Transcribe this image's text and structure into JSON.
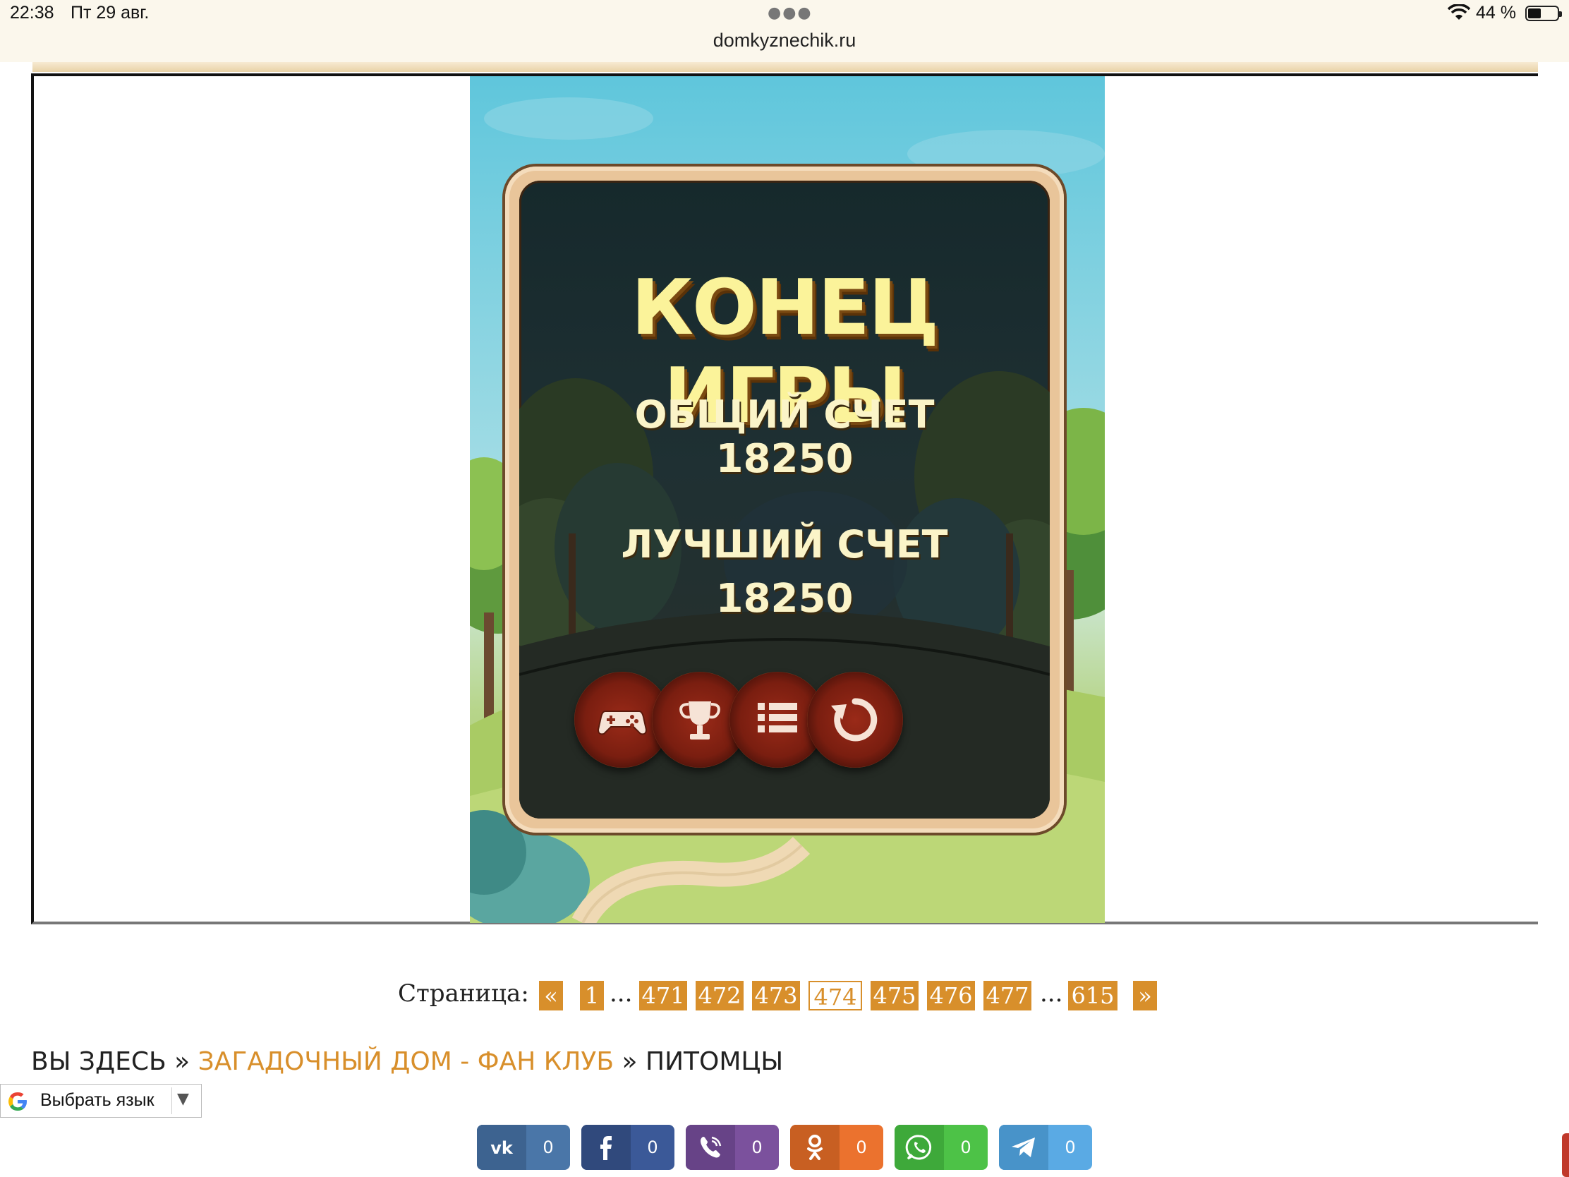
{
  "status_bar": {
    "time": "22:38",
    "date": "Пт 29 авг.",
    "url": "domkyznechik.ru",
    "battery_percent": "44 %",
    "battery_level": 0.44
  },
  "game": {
    "title": "КОНЕЦ ИГРЫ",
    "total_label": "ОБЩИЙ СЧЕТ",
    "total_value": "18250",
    "best_label": "ЛУЧШИЙ СЧЕТ",
    "best_value": "18250",
    "buttons": [
      {
        "icon": "gamepad-icon"
      },
      {
        "icon": "trophy-icon"
      },
      {
        "icon": "list-icon"
      },
      {
        "icon": "restart-icon"
      }
    ]
  },
  "pagination": {
    "label": "Страница:",
    "prev": "«",
    "next": "»",
    "ellipsis": "...",
    "pages": [
      "1",
      "471",
      "472",
      "473",
      "474",
      "475",
      "476",
      "477",
      "615"
    ],
    "current": "474"
  },
  "breadcrumb": {
    "prefix": "ВЫ ЗДЕСЬ",
    "separator": "»",
    "link": "ЗАГАДОЧНЫЙ ДОМ - ФАН КЛУБ",
    "current": "ПИТОМЦЫ"
  },
  "translate": {
    "label": "Выбрать язык",
    "arrow": "▼"
  },
  "share": [
    {
      "network": "vk",
      "count": "0",
      "color": "#4a76a8",
      "dark": "#3d6390"
    },
    {
      "network": "facebook",
      "count": "0",
      "color": "#3b5998",
      "dark": "#30497c"
    },
    {
      "network": "viber",
      "count": "0",
      "color": "#7b519d",
      "dark": "#674387"
    },
    {
      "network": "odnoklassniki",
      "count": "0",
      "color": "#eb722e",
      "dark": "#c85f22"
    },
    {
      "network": "whatsapp",
      "count": "0",
      "color": "#4dc247",
      "dark": "#3ea93a"
    },
    {
      "network": "telegram",
      "count": "0",
      "color": "#5aaae4",
      "dark": "#4893c9"
    }
  ]
}
